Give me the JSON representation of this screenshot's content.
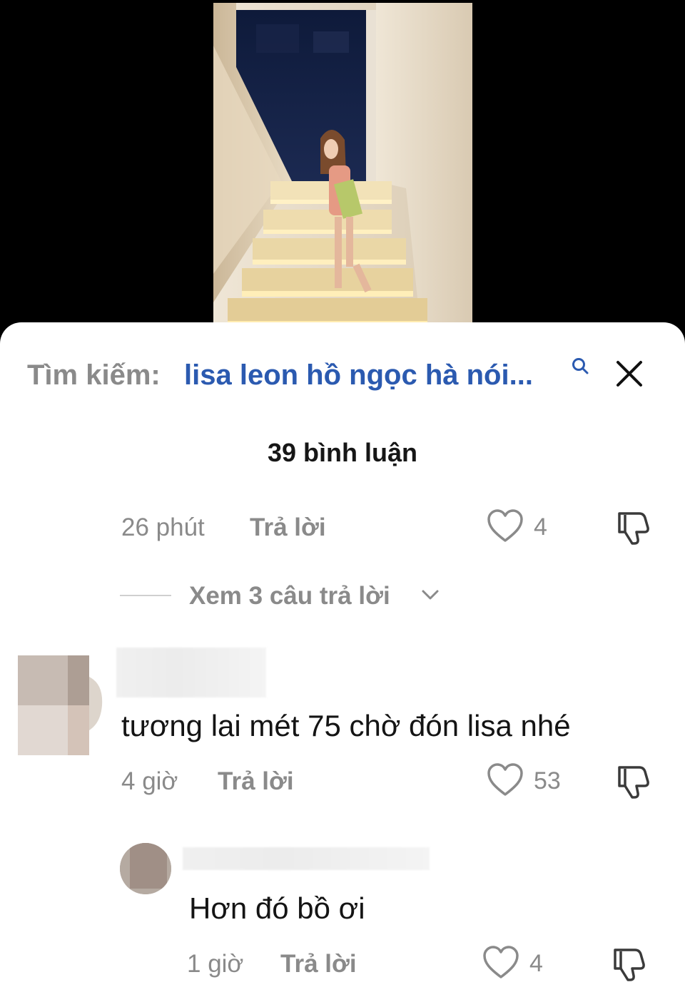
{
  "search": {
    "prefix": "Tìm kiếm:",
    "query": "lisa leon hồ ngọc hà nói...",
    "search_icon": "search-icon",
    "close_icon": "close-icon"
  },
  "comments_header": {
    "count_label": "39 bình luận"
  },
  "comment_1": {
    "time": "26 phút",
    "reply_label": "Trả lời",
    "likes": "4"
  },
  "view_replies": {
    "label": "Xem 3 câu trả lời"
  },
  "comment_2": {
    "text": "tương lai mét 75 chờ đón lisa nhé",
    "time": "4 giờ",
    "reply_label": "Trả lời",
    "likes": "53"
  },
  "reply_1": {
    "text": "Hơn đó bồ ơi",
    "time": "1 giờ",
    "reply_label": "Trả lời",
    "likes": "4"
  },
  "colors": {
    "query_blue": "#2b5ab0",
    "muted_gray": "#8a8a8a",
    "text_dark": "#141414"
  }
}
